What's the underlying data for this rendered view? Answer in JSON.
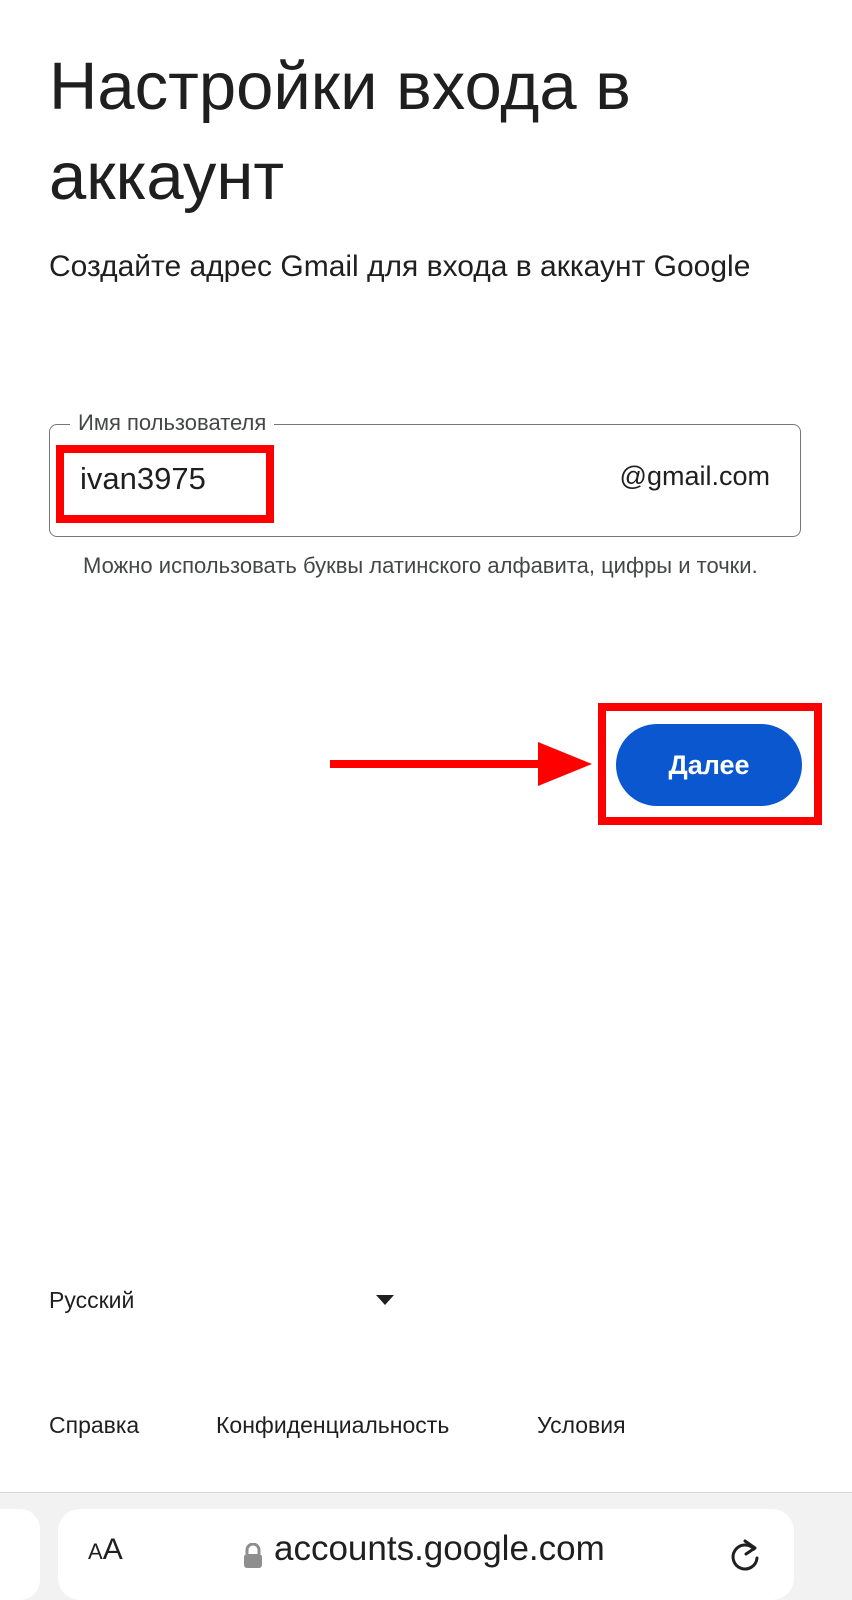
{
  "header": {
    "title": "Настройки входа в аккаунт",
    "subtitle": "Создайте адрес Gmail для входа в аккаунт Google"
  },
  "username_field": {
    "label": "Имя пользователя",
    "value": "ivan3975",
    "suffix": "@gmail.com",
    "hint": "Можно использовать буквы латинского алфавита, цифры и точки."
  },
  "actions": {
    "next_label": "Далее"
  },
  "language": {
    "selected": "Русский"
  },
  "footer": {
    "help": "Справка",
    "privacy": "Конфиденциальность",
    "terms": "Условия"
  },
  "browser": {
    "aa_small": "A",
    "aa_large": "A",
    "url": "accounts.google.com"
  },
  "colors": {
    "primary": "#0b57d0",
    "annotation": "#ff0000"
  },
  "icons": {
    "dropdown": "caret-down-icon",
    "lock": "lock-icon",
    "reload": "reload-icon",
    "arrow": "arrow-right-icon"
  }
}
